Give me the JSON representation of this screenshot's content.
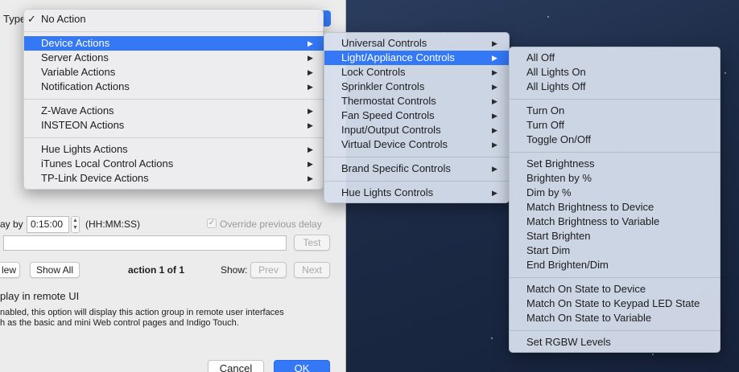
{
  "dialog": {
    "type_label": "Type",
    "delay_prefix": "ay by",
    "delay_value": "0:15:00",
    "delay_format": "(HH:MM:SS)",
    "override_label": "Override previous delay",
    "test_button": "Test",
    "new_button": "lew",
    "show_all_button": "Show All",
    "action_count": "action 1 of 1",
    "show_label": "Show:",
    "prev_button": "Prev",
    "next_button": "Next",
    "display_remote": "play in remote UI",
    "description_line1": "nabled, this option will display this action group in remote user interfaces",
    "description_line2": "h as the basic and mini Web control pages and Indigo Touch.",
    "cancel_button": "Cancel",
    "ok_button": "OK"
  },
  "menu1": {
    "checkmark": "✓",
    "items": [
      {
        "label": "No Action"
      },
      {
        "label": "Device Actions",
        "submenu": true,
        "highlighted": true
      },
      {
        "label": "Server Actions",
        "submenu": true
      },
      {
        "label": "Variable Actions",
        "submenu": true
      },
      {
        "label": "Notification Actions",
        "submenu": true
      },
      {
        "label": "Z-Wave Actions",
        "submenu": true
      },
      {
        "label": "INSTEON Actions",
        "submenu": true
      },
      {
        "label": "Hue Lights Actions",
        "submenu": true
      },
      {
        "label": "iTunes Local Control Actions",
        "submenu": true
      },
      {
        "label": "TP-Link Device Actions",
        "submenu": true
      }
    ]
  },
  "menu2": {
    "items": [
      {
        "label": "Universal Controls",
        "submenu": true
      },
      {
        "label": "Light/Appliance Controls",
        "submenu": true,
        "highlighted": true
      },
      {
        "label": "Lock Controls",
        "submenu": true
      },
      {
        "label": "Sprinkler Controls",
        "submenu": true
      },
      {
        "label": "Thermostat Controls",
        "submenu": true
      },
      {
        "label": "Fan Speed Controls",
        "submenu": true
      },
      {
        "label": "Input/Output Controls",
        "submenu": true
      },
      {
        "label": "Virtual Device Controls",
        "submenu": true
      },
      {
        "label": "Brand Specific Controls",
        "submenu": true
      },
      {
        "label": "Hue Lights Controls",
        "submenu": true
      }
    ]
  },
  "menu3": {
    "items": [
      {
        "label": "All Off"
      },
      {
        "label": "All Lights On"
      },
      {
        "label": "All Lights Off"
      },
      {
        "label": "Turn On"
      },
      {
        "label": "Turn Off"
      },
      {
        "label": "Toggle On/Off"
      },
      {
        "label": "Set Brightness"
      },
      {
        "label": "Brighten by %"
      },
      {
        "label": "Dim by %"
      },
      {
        "label": "Match Brightness to Device"
      },
      {
        "label": "Match Brightness to Variable"
      },
      {
        "label": "Start Brighten"
      },
      {
        "label": "Start Dim"
      },
      {
        "label": "End Brighten/Dim"
      },
      {
        "label": "Match On State to Device"
      },
      {
        "label": "Match On State to Keypad LED State"
      },
      {
        "label": "Match On State to Variable"
      },
      {
        "label": "Set RGBW Levels"
      }
    ]
  },
  "icons": {
    "submenu_arrow": "▶",
    "stepper_up": "▲",
    "stepper_down": "▼",
    "check": "✓"
  },
  "colors": {
    "highlight": "#3478f6",
    "desktop": "#1f2e4a"
  }
}
